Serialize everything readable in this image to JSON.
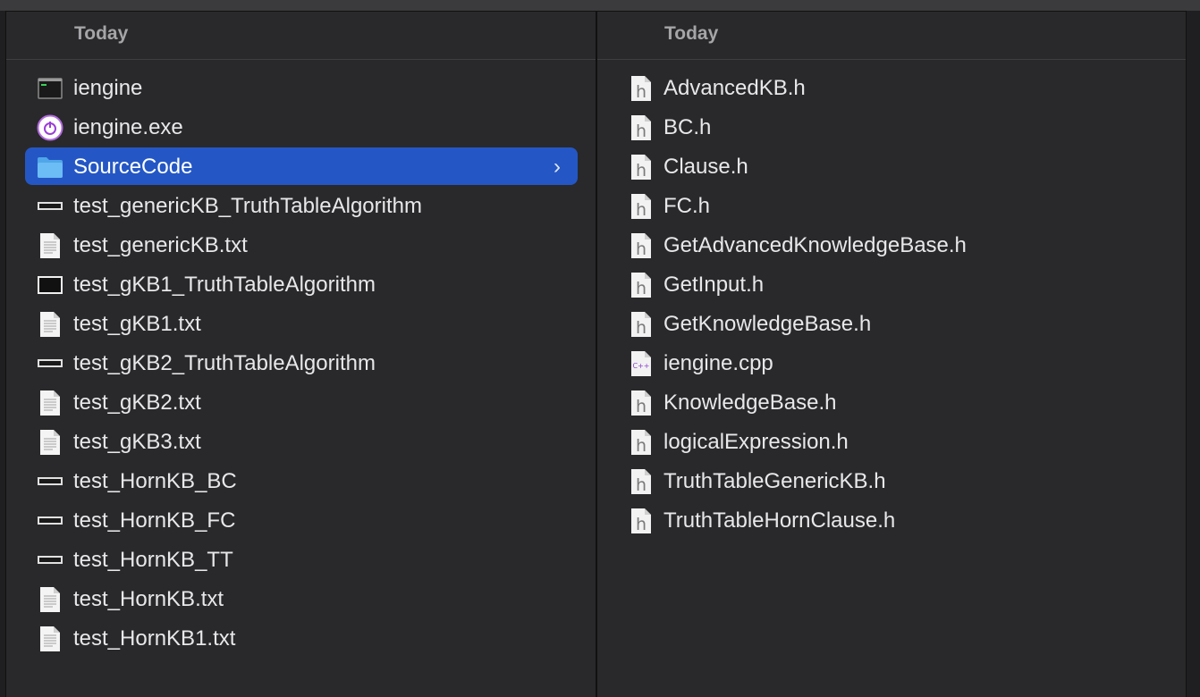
{
  "left_column": {
    "header": "Today",
    "items": [
      {
        "name": "iengine",
        "icon": "terminal-exec-icon"
      },
      {
        "name": "iengine.exe",
        "icon": "exe-power-icon"
      },
      {
        "name": "SourceCode",
        "icon": "folder-icon",
        "selected": true
      },
      {
        "name": "test_genericKB_TruthTableAlgorithm",
        "icon": "exec-bar-icon"
      },
      {
        "name": "test_genericKB.txt",
        "icon": "text-doc-icon"
      },
      {
        "name": "test_gKB1_TruthTableAlgorithm",
        "icon": "exec-window-icon"
      },
      {
        "name": "test_gKB1.txt",
        "icon": "text-doc-icon"
      },
      {
        "name": "test_gKB2_TruthTableAlgorithm",
        "icon": "exec-bar-icon"
      },
      {
        "name": "test_gKB2.txt",
        "icon": "text-doc-icon"
      },
      {
        "name": "test_gKB3.txt",
        "icon": "text-doc-icon"
      },
      {
        "name": "test_HornKB_BC",
        "icon": "exec-bar-icon"
      },
      {
        "name": "test_HornKB_FC",
        "icon": "exec-bar-icon"
      },
      {
        "name": "test_HornKB_TT",
        "icon": "exec-bar-icon"
      },
      {
        "name": "test_HornKB.txt",
        "icon": "text-doc-icon"
      },
      {
        "name": "test_HornKB1.txt",
        "icon": "text-doc-icon"
      }
    ],
    "chevron": "›"
  },
  "right_column": {
    "header": "Today",
    "items": [
      {
        "name": "AdvancedKB.h",
        "icon": "h-file-icon"
      },
      {
        "name": "BC.h",
        "icon": "h-file-icon"
      },
      {
        "name": "Clause.h",
        "icon": "h-file-icon"
      },
      {
        "name": "FC.h",
        "icon": "h-file-icon"
      },
      {
        "name": "GetAdvancedKnowledgeBase.h",
        "icon": "h-file-icon"
      },
      {
        "name": "GetInput.h",
        "icon": "h-file-icon"
      },
      {
        "name": "GetKnowledgeBase.h",
        "icon": "h-file-icon"
      },
      {
        "name": "iengine.cpp",
        "icon": "cpp-file-icon"
      },
      {
        "name": "KnowledgeBase.h",
        "icon": "h-file-icon"
      },
      {
        "name": "logicalExpression.h",
        "icon": "h-file-icon"
      },
      {
        "name": "TruthTableGenericKB.h",
        "icon": "h-file-icon"
      },
      {
        "name": "TruthTableHornClause.h",
        "icon": "h-file-icon"
      }
    ]
  },
  "colors": {
    "selection": "#2457c5",
    "background": "#29292b",
    "text": "#e8e8ea",
    "header_text": "#a5a5a8"
  }
}
